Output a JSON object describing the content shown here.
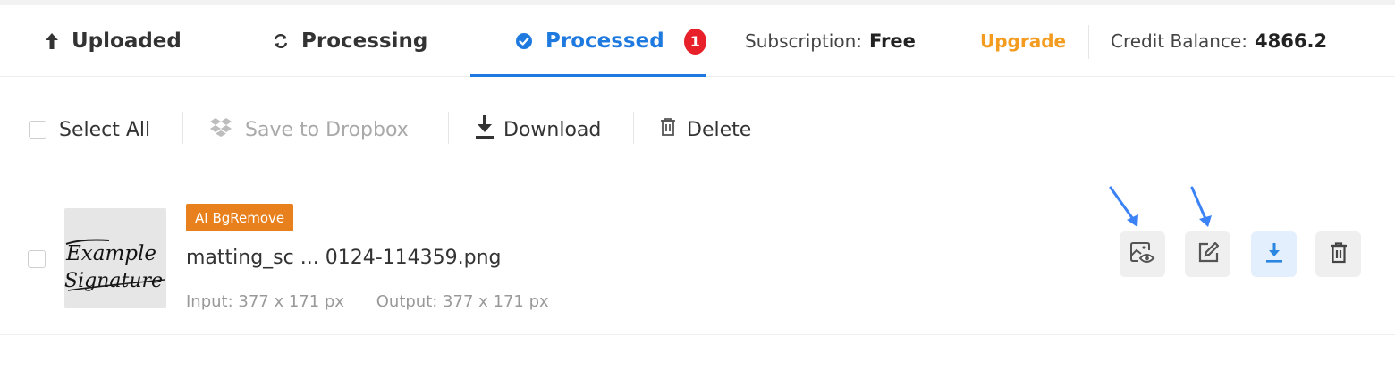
{
  "tabs": {
    "uploaded": "Uploaded",
    "processing": "Processing",
    "processed": "Processed",
    "processed_count": "1"
  },
  "account": {
    "subscription_label": "Subscription:",
    "subscription_value": "Free",
    "upgrade": "Upgrade",
    "credit_label": "Credit Balance:",
    "credit_value": "4866.2"
  },
  "toolbar": {
    "select_all": "Select All",
    "save_to_dropbox": "Save to Dropbox",
    "download": "Download",
    "delete": "Delete"
  },
  "file": {
    "tag": "AI BgRemove",
    "name": "matting_sc ... 0124-114359.png",
    "input": "Input: 377 x 171 px",
    "output": "Output: 377 x 171 px",
    "thumb_text_1": "Example",
    "thumb_text_2": "Signature"
  },
  "colors": {
    "accent": "#1f7ae0",
    "badge": "#e8202a",
    "upgrade": "#f39c1f",
    "tag": "#e8811d",
    "annotation_arrow": "#3b82f6"
  },
  "icons": [
    "arrow-up-icon",
    "refresh-icon",
    "check-circle-icon",
    "dropbox-icon",
    "download-icon",
    "trash-icon",
    "preview-icon",
    "edit-icon"
  ]
}
